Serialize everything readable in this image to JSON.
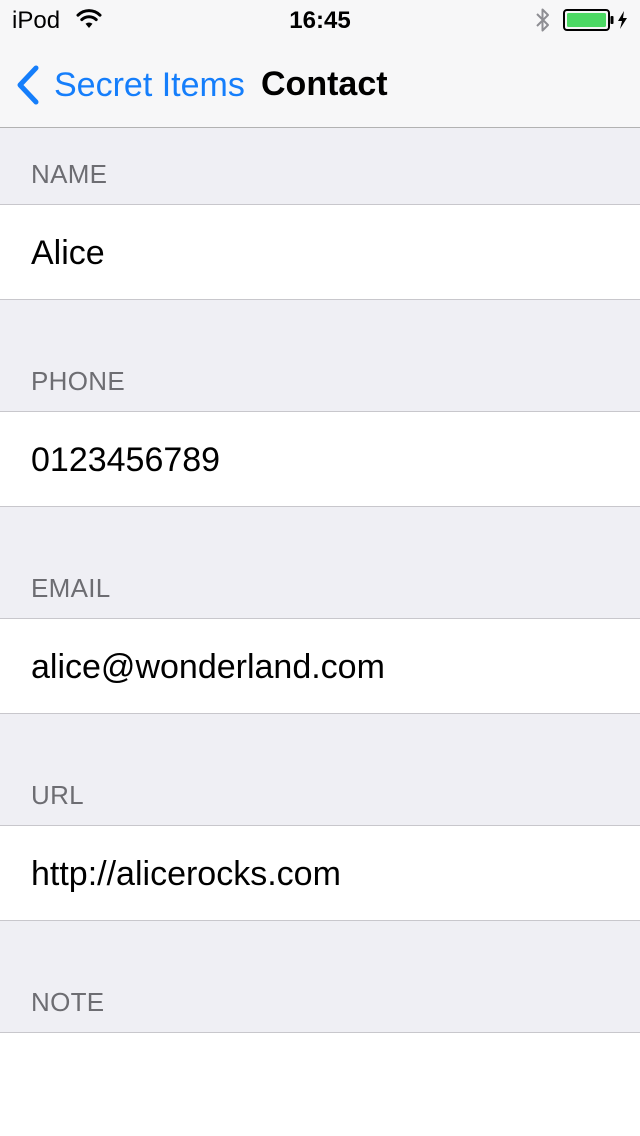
{
  "status_bar": {
    "carrier": "iPod",
    "time": "16:45",
    "icons": [
      "wifi-icon",
      "bluetooth-icon",
      "battery-charging-icon"
    ],
    "battery_color": "#4cd964"
  },
  "nav": {
    "back_label": "Secret Items",
    "title": "Contact",
    "accent_color": "#157efb"
  },
  "sections": {
    "name": {
      "header": "NAME",
      "value": "Alice"
    },
    "phone": {
      "header": "PHONE",
      "value": "0123456789"
    },
    "email": {
      "header": "EMAIL",
      "value": "alice@wonderland.com"
    },
    "url": {
      "header": "URL",
      "value": "http://alicerocks.com"
    },
    "note": {
      "header": "NOTE",
      "value": ""
    }
  }
}
